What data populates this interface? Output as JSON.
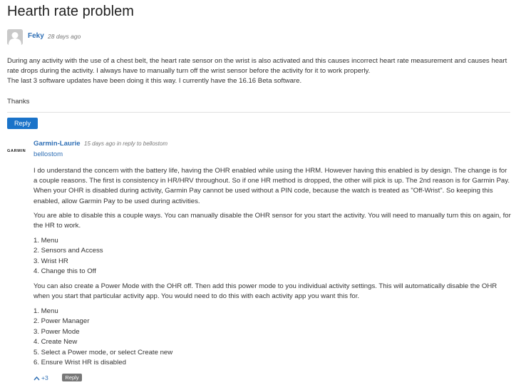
{
  "post": {
    "title": "Hearth rate problem",
    "author": "Feky",
    "time": "28 days ago",
    "paragraph1": "During any activity with the use of a chest belt, the heart rate sensor on the wrist is also activated and this causes incorrect heart rate measurement and causes heart rate drops during the activity. I always have to manually turn off the wrist sensor before the activity for it to work properly.",
    "paragraph2": "The last 3 software updates have been doing it this way. I currently have the 16.16 Beta software.",
    "thanks": "Thanks",
    "reply_label": "Reply"
  },
  "reply": {
    "logo_text": "GARMIN",
    "author": "Garmin-Laurie",
    "time": "15 days ago",
    "in_reply_prefix": "in reply to",
    "in_reply_to": "bellostom",
    "mention": "bellostom",
    "paragraph1": "I do understand the concern with the battery life, having the OHR enabled while using the HRM. However having this enabled is by design. The change is for a couple reasons. The first is consistency in HR/HRV throughout. So if one HR method is dropped, the other will pick is up. The 2nd reason is for Garmin Pay. When your OHR is disabled during activity, Garmin Pay cannot be used without a PIN code, because the watch is treated as \"Off-Wrist\". So keeping this enabled, allow Garmin Pay to be used during activities.",
    "paragraph2": "You are able to disable this a couple ways. You can manually disable the OHR sensor for you start the activity. You will need to manually turn this on again, for the HR to work.",
    "steps1": [
      "1. Menu",
      "2. Sensors and Access",
      "3. Wrist HR",
      "4. Change this to Off"
    ],
    "paragraph3": "You can also create a Power Mode with the OHR off. Then add this power mode to you individual activity settings. This will automatically disable the OHR when you start that particular activity app. You would need to do this with each activity app you want this for.",
    "steps2": [
      "1. Menu",
      "2. Power Manager",
      "3. Power Mode",
      "4. Create New",
      "5. Select a Power mode, or select Create new",
      "6. Ensure Wrist HR is disabled"
    ],
    "vote_count": "+3",
    "reply_label": "Reply"
  },
  "colors": {
    "link": "#2f6fb5",
    "reply_button": "#1a73c9",
    "reply_small_button": "#777777"
  }
}
